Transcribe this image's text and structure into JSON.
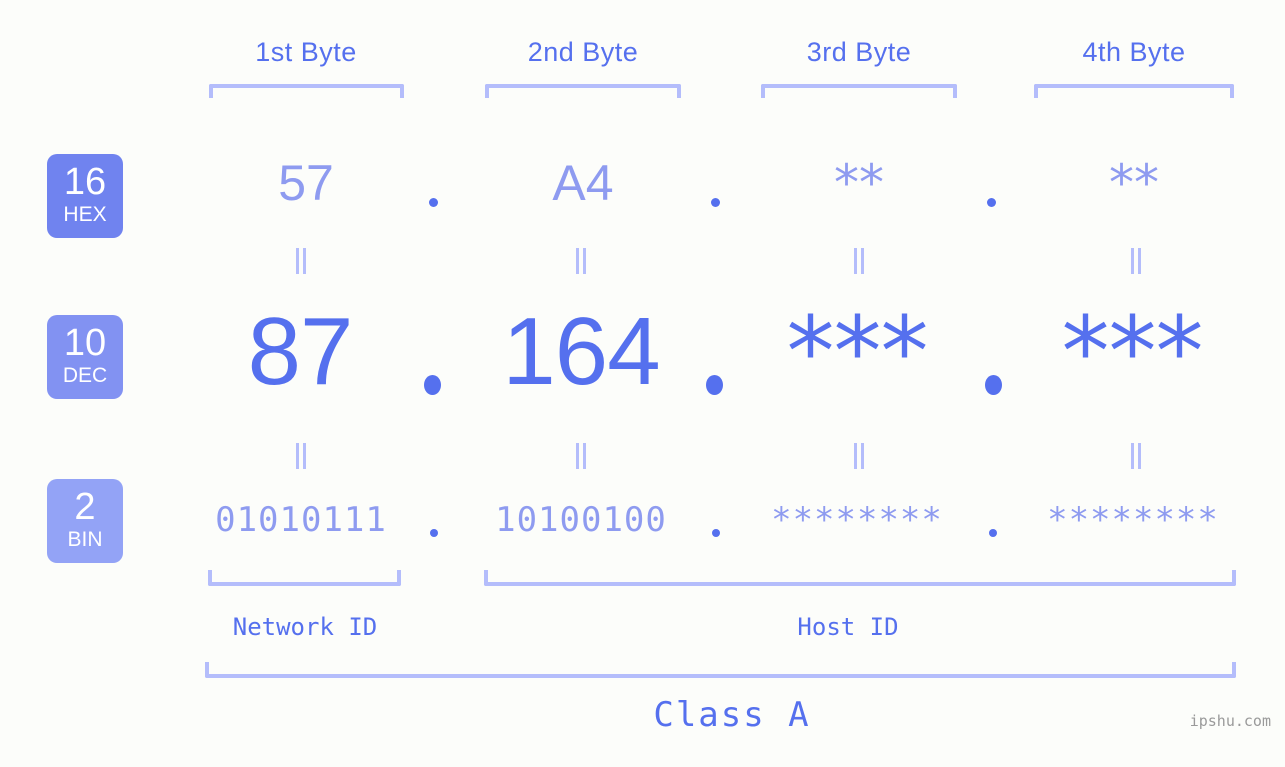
{
  "watermark": "ipshu.com",
  "byte_headers": [
    {
      "label": "1st Byte"
    },
    {
      "label": "2nd Byte"
    },
    {
      "label": "3rd Byte"
    },
    {
      "label": "4th Byte"
    }
  ],
  "bases": [
    {
      "number": "16",
      "name": "HEX",
      "color": "#7083ef"
    },
    {
      "number": "10",
      "name": "DEC",
      "color": "#8292f2"
    },
    {
      "number": "2",
      "name": "BIN",
      "color": "#93a3f6"
    }
  ],
  "rows": {
    "hex": {
      "base_number": "16",
      "base_name": "HEX",
      "values": [
        "57",
        "A4",
        "**",
        "**"
      ],
      "separator": "."
    },
    "dec": {
      "base_number": "10",
      "base_name": "DEC",
      "values": [
        "87",
        "164",
        "***",
        "***"
      ],
      "separator": "."
    },
    "bin": {
      "base_number": "2",
      "base_name": "BIN",
      "values": [
        "01010111",
        "10100100",
        "********",
        "********"
      ],
      "separator": "."
    }
  },
  "equals_marker": "=",
  "segments": {
    "network_id": "Network ID",
    "host_id": "Host ID"
  },
  "class": {
    "label": "Class A"
  },
  "colors": {
    "background": "#fcfdfa",
    "primary": "#5570ee",
    "light": "#8e9bf0",
    "bracket": "#b4bdfb",
    "badge_hex": "#7083ef",
    "badge_dec": "#8292f2",
    "badge_bin": "#93a3f6",
    "watermark": "#9a9a9a"
  }
}
